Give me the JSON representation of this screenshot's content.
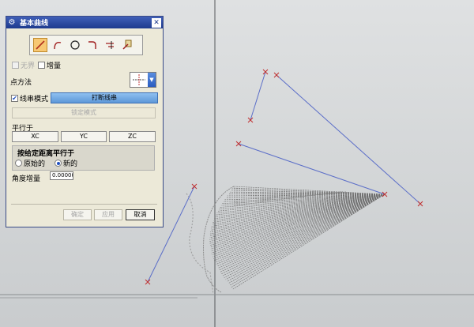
{
  "dialog": {
    "title": "基本曲线",
    "infinite_label": "无界",
    "increment_label": "增量",
    "point_method_label": "点方法",
    "chain_mode_label": "线串模式",
    "break_chain_label": "打断线串",
    "lock_mode_label": "锁定模式",
    "parallel_to_label": "平行于",
    "xc_label": "XC",
    "yc_label": "YC",
    "zc_label": "ZC",
    "distance_group_title": "按给定距离平行于",
    "original_label": "原始的",
    "new_label": "新的",
    "angle_increment_label": "角度增量",
    "angle_increment_value": "0.00000",
    "ok_label": "确定",
    "apply_label": "应用",
    "cancel_label": "取消",
    "chain_mode_checked": true,
    "increment_checked": false,
    "infinite_checked": false,
    "selected_radio": "new"
  },
  "tools": [
    {
      "name": "line-icon",
      "active": true
    },
    {
      "name": "arc-icon",
      "active": false
    },
    {
      "name": "circle-icon",
      "active": false
    },
    {
      "name": "fillet-icon",
      "active": false
    },
    {
      "name": "trim-icon",
      "active": false
    },
    {
      "name": "edit-curve-parameters-icon",
      "active": false
    }
  ],
  "colors": {
    "viewport_bg": "#d6d8da",
    "line_color": "#5b6ec8",
    "point_color": "#c03030",
    "mesh_color": "#6a6a6a",
    "title_bar": "#2a4aa0"
  }
}
